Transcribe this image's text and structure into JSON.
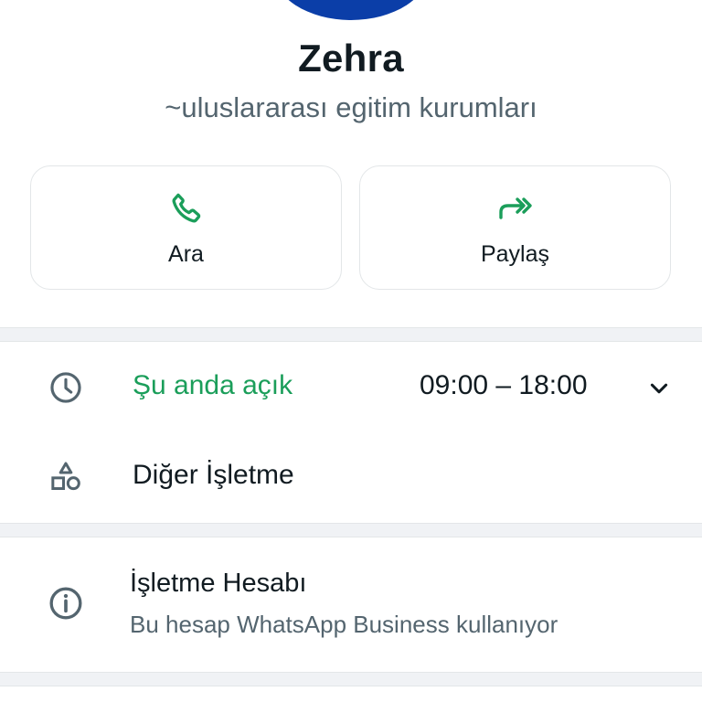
{
  "profile": {
    "name": "Zehra",
    "about": "~uluslararası egitim kurumları"
  },
  "actions": [
    {
      "label": "Ara",
      "icon": "phone-icon"
    },
    {
      "label": "Paylaş",
      "icon": "forward-icon"
    }
  ],
  "hours": {
    "status": "Şu anda açık",
    "range": "09:00 – 18:00",
    "icon": "clock-icon",
    "expand_icon": "chevron-down-icon"
  },
  "category": {
    "label": "Diğer İşletme",
    "icon": "shapes-icon"
  },
  "business_account": {
    "title": "İşletme Hesabı",
    "description": "Bu hesap WhatsApp Business kullanıyor",
    "icon": "info-icon"
  },
  "colors": {
    "accent": "#1b9e5a",
    "avatar": "#0b3ea8",
    "secondary_text": "#54656f"
  }
}
